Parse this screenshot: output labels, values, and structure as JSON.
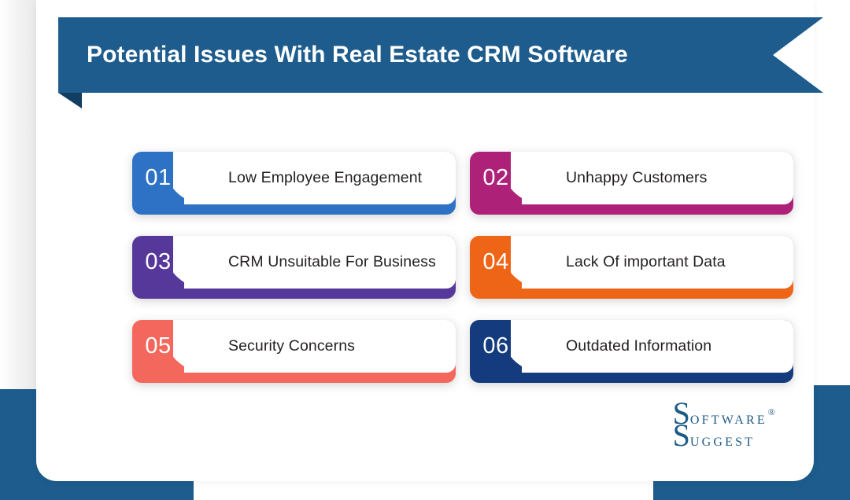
{
  "header": {
    "title": "Potential Issues With Real Estate CRM Software",
    "ribbon_color": "#1d5c8d",
    "fold_color": "#123e61",
    "title_color": "#ffffff"
  },
  "background": {
    "panel_color": "#ffffff",
    "block_color": "#1d5c8d",
    "page_color": "#ffffff"
  },
  "cards": [
    {
      "number": "01",
      "label": "Low Employee Engagement",
      "color": "#2d72c4"
    },
    {
      "number": "02",
      "label": "Unhappy Customers",
      "color": "#ad2179"
    },
    {
      "number": "03",
      "label": "CRM Unsuitable For Business",
      "color": "#56379a"
    },
    {
      "number": "04",
      "label": "Lack Of important Data",
      "color": "#ef6517"
    },
    {
      "number": "05",
      "label": "Security Concerns",
      "color": "#f4675c"
    },
    {
      "number": "06",
      "label": "Outdated Information",
      "color": "#133b7d"
    }
  ],
  "logo": {
    "line1_cap": "S",
    "line1_rest": "oftware",
    "registered": "®",
    "line2_cap": "S",
    "line2_rest": "uggest",
    "color": "#1d5b87"
  }
}
